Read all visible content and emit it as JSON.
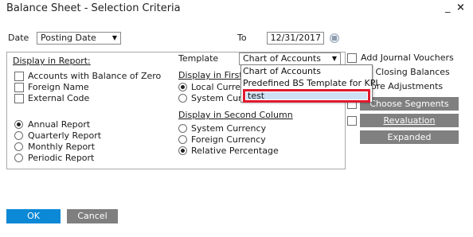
{
  "window": {
    "title": "Balance Sheet - Selection Criteria",
    "minimize": "_",
    "close": "×"
  },
  "date": {
    "label": "Date",
    "value": "Posting Date",
    "to_label": "To",
    "to_value": "12/31/2017"
  },
  "display_in_report": {
    "heading": "Display in Report:",
    "checkboxes": [
      "Accounts with Balance of Zero",
      "Foreign Name",
      "External Code"
    ],
    "periods": [
      "Annual Report",
      "Quarterly Report",
      "Monthly Report",
      "Periodic Report"
    ],
    "selected_period": "Annual Report"
  },
  "template": {
    "label": "Template",
    "value": "Chart of Accounts",
    "options": [
      "Chart of Accounts",
      "Predefined BS Template for KPI",
      "test"
    ],
    "highlighted": "test"
  },
  "display_first": {
    "heading": "Display in First C",
    "options": [
      "Local Curren",
      "System Cur"
    ],
    "selected": "Local Curren"
  },
  "display_second": {
    "heading": "Display in Second Column",
    "options": [
      "System Currency",
      "Foreign Currency",
      "Relative Percentage"
    ],
    "selected": "Relative Percentage"
  },
  "right_options": {
    "add_journal_vouchers": "Add Journal Vouchers",
    "closing_balances": "d Closing Balances",
    "fore_adjustments": "ore Adjustments"
  },
  "buttons": {
    "choose_segments": "Choose Segments",
    "revaluation": "Revaluation",
    "expanded": "Expanded",
    "ok": "OK",
    "cancel": "Cancel"
  },
  "colors": {
    "ok_blue": "#0b88d6",
    "gray_button": "#808080",
    "highlight_red": "#e0182d"
  }
}
